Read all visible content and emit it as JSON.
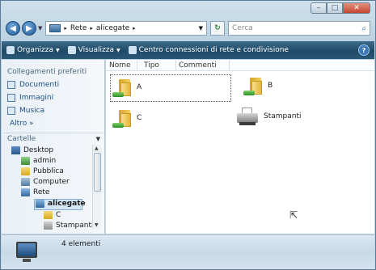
{
  "window": {
    "caption_buttons": {
      "minimize": "–",
      "maximize": "□",
      "close": "✕"
    }
  },
  "address_bar": {
    "back_icon": "back-arrow",
    "forward_icon": "forward-arrow",
    "crumbs": [
      "Rete",
      "alicegate"
    ],
    "separator": "▸",
    "search_placeholder": "Cerca",
    "refresh_glyph": "↻"
  },
  "toolbar": {
    "organizza": "Organizza",
    "visualizza": "Visualizza",
    "centro": "Centro connessioni di rete e condivisione",
    "help": "?",
    "bg_color": "#24506e"
  },
  "navigation": {
    "favorites_title": "Collegamenti preferiti",
    "favorites": [
      "Documenti",
      "Immagini",
      "Musica"
    ],
    "more": "Altro »",
    "folders_title": "Cartelle",
    "tree": [
      {
        "label": "Desktop",
        "icon": "desktop-icon"
      },
      {
        "label": "admin",
        "icon": "user-folder-icon"
      },
      {
        "label": "Pubblica",
        "icon": "folder-icon"
      },
      {
        "label": "Computer",
        "icon": "computer-icon"
      },
      {
        "label": "Rete",
        "icon": "network-icon"
      },
      {
        "label": "alicegate",
        "icon": "network-computer-icon",
        "selected": true
      },
      {
        "label": "C",
        "icon": "shared-folder-icon"
      },
      {
        "label": "Stampanti",
        "icon": "printer-icon"
      }
    ]
  },
  "content": {
    "columns": [
      "Nome",
      "Tipo",
      "Commenti"
    ],
    "items": [
      {
        "label": "A",
        "kind": "shared-folder",
        "focused": true
      },
      {
        "label": "B",
        "kind": "shared-folder"
      },
      {
        "label": "C",
        "kind": "shared-folder"
      },
      {
        "label": "Stampanti",
        "kind": "printers"
      }
    ]
  },
  "details": {
    "count_text": "4 elementi"
  }
}
